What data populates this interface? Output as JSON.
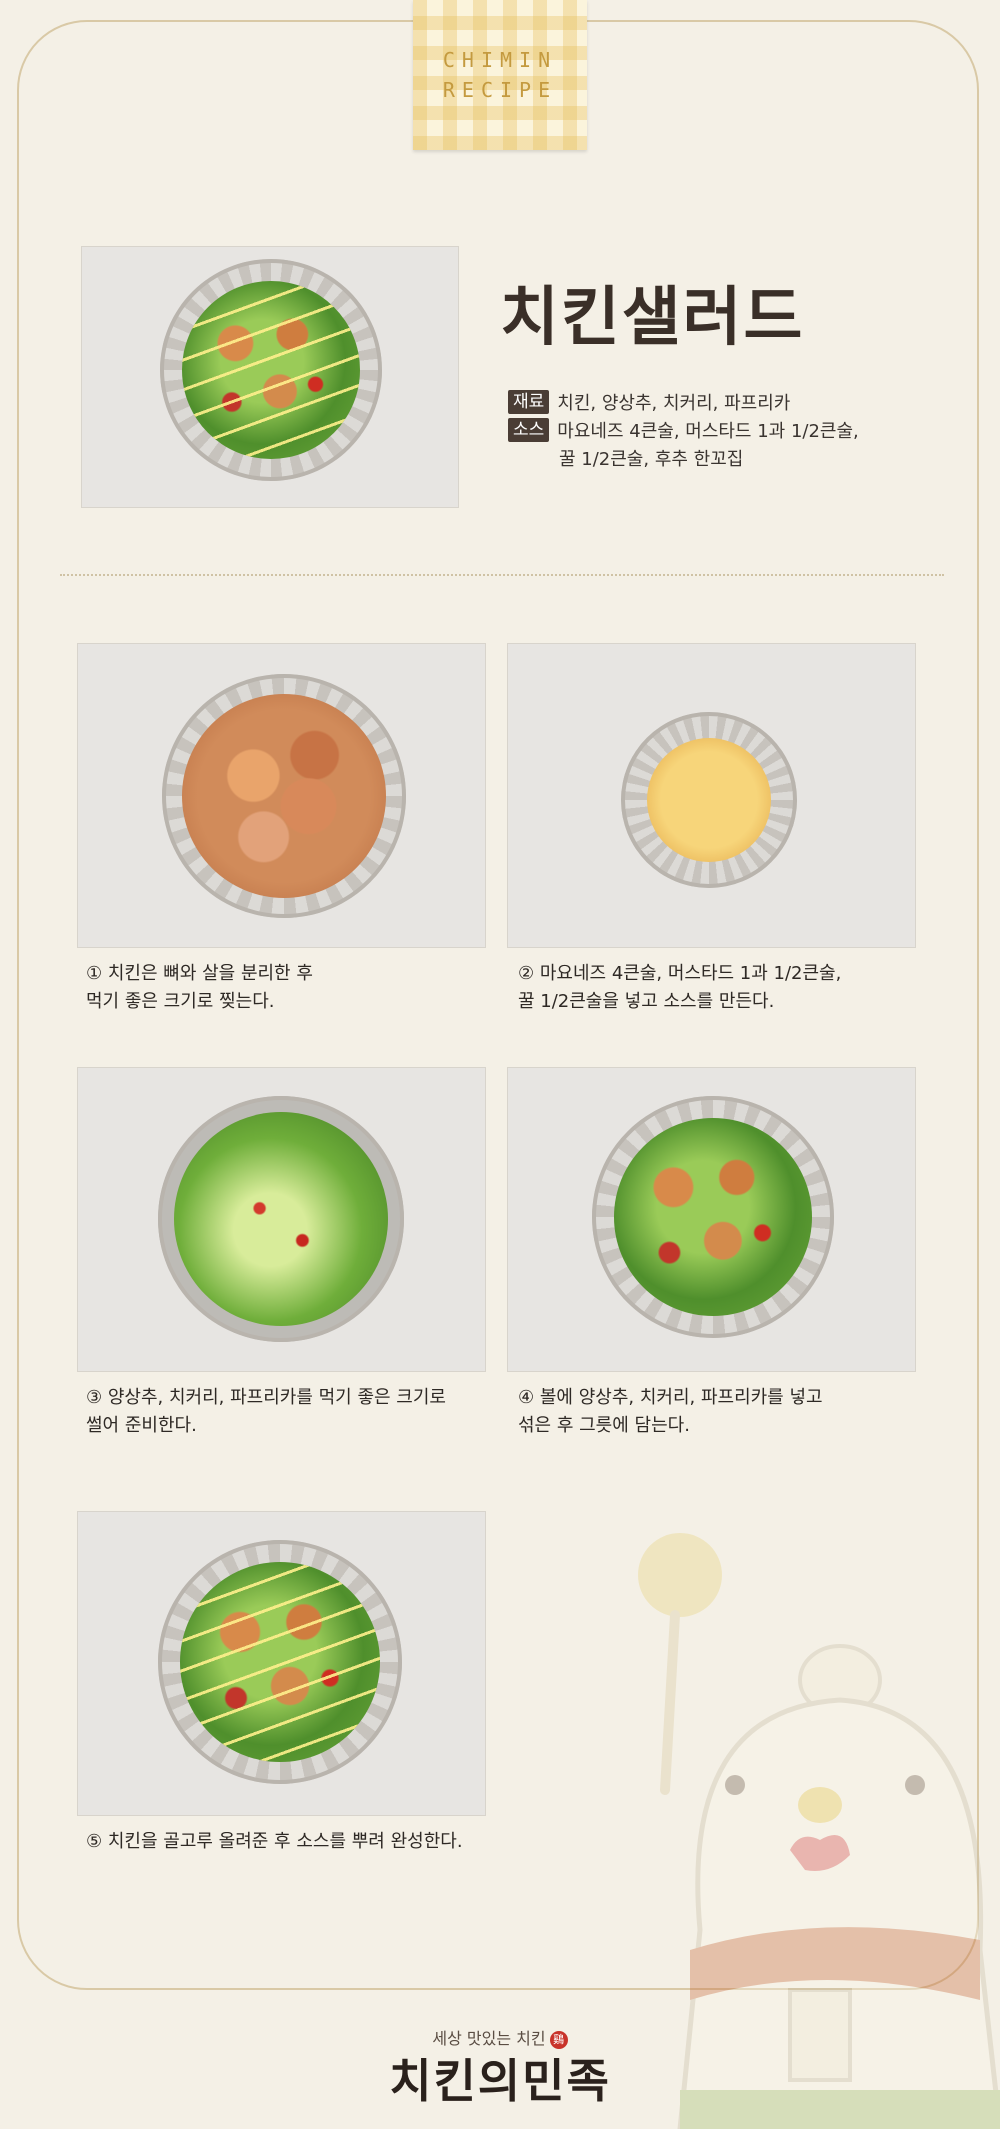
{
  "ribbon": {
    "line1": "CHIMIN",
    "line2": "RECIPE"
  },
  "title": "치킨샐러드",
  "ingredients": {
    "tag1": "재료",
    "text1": "치킨, 양상추, 치커리, 파프리카",
    "tag2": "소스",
    "text2_line1": "마요네즈 4큰술, 머스타드 1과 1/2큰술,",
    "text2_line2": "꿀 1/2큰술, 후추 한꼬집"
  },
  "steps": [
    {
      "line1": "① 치킨은 뼈와 살을 분리한 후",
      "line2": "먹기 좋은 크기로 찢는다."
    },
    {
      "line1": "② 마요네즈 4큰술, 머스타드 1과 1/2큰술,",
      "line2": "꿀 1/2큰술을 넣고 소스를 만든다."
    },
    {
      "line1": "③ 양상추, 치커리, 파프리카를 먹기 좋은 크기로",
      "line2": "썰어 준비한다."
    },
    {
      "line1": "④ 볼에 양상추, 치커리, 파프리카를 넣고",
      "line2": "섞은 후 그릇에 담는다."
    },
    {
      "line1": "⑤ 치킨을 골고루 올려준 후 소스를 뿌려 완성한다.",
      "line2": ""
    }
  ],
  "footer": {
    "tagline": "세상 맛있는 치킨",
    "seal": "鷄",
    "brand": "치킨의민족"
  }
}
